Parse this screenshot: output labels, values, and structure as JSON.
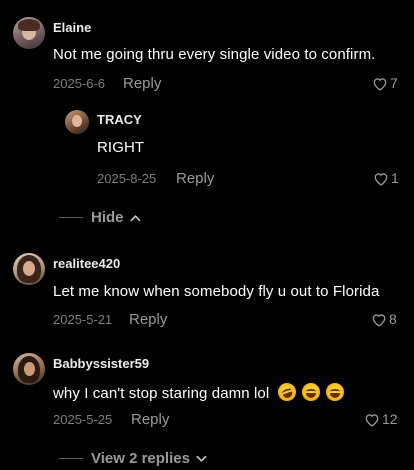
{
  "comments": [
    {
      "username": "Elaine",
      "text": "Not me going thru every single video to confirm.",
      "date": "2025-6-6",
      "reply_label": "Reply",
      "likes": "7",
      "replies": [
        {
          "username": "TRACY",
          "text": "RIGHT",
          "date": "2025-8-25",
          "reply_label": "Reply",
          "likes": "1"
        }
      ],
      "thread_toggle": "Hide"
    },
    {
      "username": "realitee420",
      "text": "Let me know when somebody fly u out to Florida",
      "date": "2025-5-21",
      "reply_label": "Reply",
      "likes": "8"
    },
    {
      "username": "Babbyssister59",
      "text": "why I can't stop staring damn lol",
      "emojis": [
        "rofl-emoji",
        "joy-emoji",
        "joy-emoji"
      ],
      "date": "2025-5-25",
      "reply_label": "Reply",
      "likes": "12",
      "thread_toggle": "View 2 replies"
    }
  ],
  "colors": {
    "background": "#000000",
    "primary_text": "#ffffff",
    "secondary_text": "#9a9a9a",
    "date_text": "#7e7e7e"
  },
  "icons": {
    "like": "heart-outline-icon",
    "collapse": "chevron-up-icon",
    "expand": "chevron-down-icon"
  }
}
